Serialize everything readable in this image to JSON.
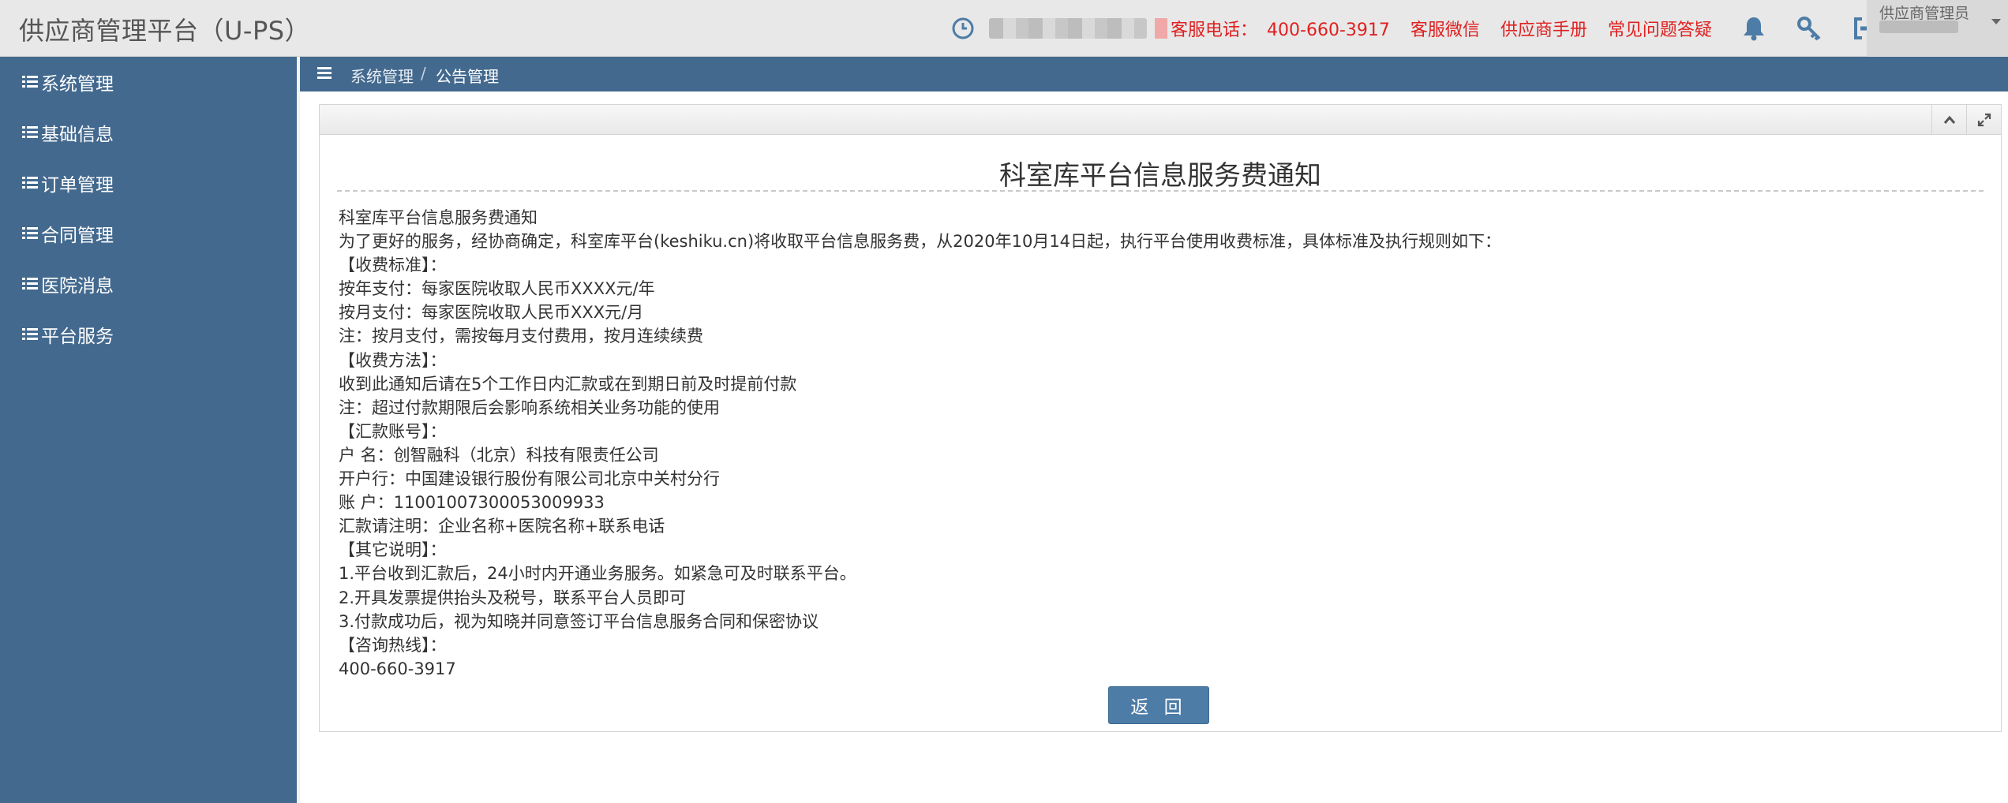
{
  "header": {
    "brand": "供应商管理平台（U-PS）",
    "hotline_label": "客服电话：",
    "hotline_number": "400-660-3917",
    "links": [
      "客服微信",
      "供应商手册",
      "常见问题答疑"
    ],
    "user_role": "供应商管理员",
    "icons": [
      "clock-icon",
      "bell-icon",
      "key-icon",
      "logout-icon"
    ],
    "link_color": "#e02020"
  },
  "sidebar": {
    "items": [
      {
        "label": "系统管理",
        "icon": "list-icon"
      },
      {
        "label": "基础信息",
        "icon": "list-icon"
      },
      {
        "label": "订单管理",
        "icon": "list-icon"
      },
      {
        "label": "合同管理",
        "icon": "list-icon"
      },
      {
        "label": "医院消息",
        "icon": "list-icon"
      },
      {
        "label": "平台服务",
        "icon": "list-icon"
      }
    ],
    "bg_color": "#43698e"
  },
  "breadcrumb": {
    "items": [
      "系统管理",
      "公告管理"
    ],
    "separator": "/"
  },
  "notice": {
    "title": "科室库平台信息服务费通知",
    "lines": [
      "科室库平台信息服务费通知",
      "为了更好的服务，经协商确定，科室库平台(keshiku.cn)将收取平台信息服务费，从2020年10月14日起，执行平台使用收费标准，具体标准及执行规则如下：",
      "【收费标准】：",
      "按年支付：每家医院收取人民币XXXX元/年",
      "按月支付：每家医院收取人民币XXX元/月",
      "注：按月支付，需按每月支付费用，按月连续续费",
      "【收费方法】：",
      "收到此通知后请在5个工作日内汇款或在到期日前及时提前付款",
      "注：超过付款期限后会影响系统相关业务功能的使用",
      "【汇款账号】：",
      "户 名：创智融科（北京）科技有限责任公司",
      "开户行：中国建设银行股份有限公司北京中关村分行",
      "账 户：11001007300053009933",
      "汇款请注明：企业名称+医院名称+联系电话",
      "【其它说明】：",
      "1.平台收到汇款后，24小时内开通业务服务。如紧急可及时联系平台。",
      "2.开具发票提供抬头及税号，联系平台人员即可",
      "3.付款成功后，视为知晓并同意签订平台信息服务合同和保密协议",
      "【咨询热线】：",
      "400-660-3917"
    ],
    "back_button": "返 回",
    "panel_tools": [
      "chevron-up-icon",
      "expand-icon"
    ]
  }
}
